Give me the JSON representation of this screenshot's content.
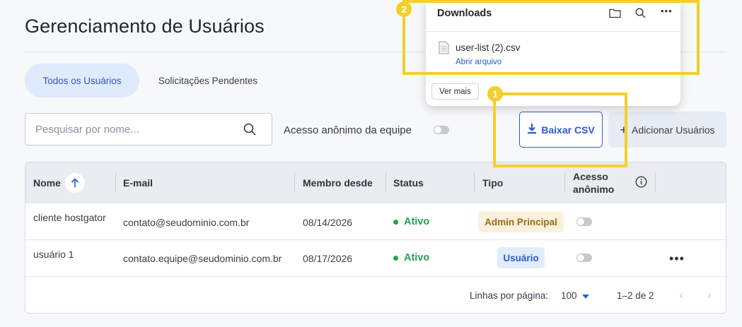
{
  "page": {
    "title": "Gerenciamento de Usuários"
  },
  "tabs": [
    {
      "label": "Todos os Usuários",
      "active": true
    },
    {
      "label": "Solicitações Pendentes",
      "active": false
    }
  ],
  "search": {
    "placeholder": "Pesquisar por nome...",
    "value": "",
    "icon": "search-icon"
  },
  "anonymous_access": {
    "label": "Acesso anônimo da equipe",
    "enabled": false
  },
  "toolbar": {
    "download_csv_label": "Baixar CSV",
    "add_users_label": "Adicionar Usuários"
  },
  "table": {
    "columns": [
      "Nome",
      "E-mail",
      "Membro desde",
      "Status",
      "Tipo",
      "Acesso anônimo"
    ],
    "rows": [
      {
        "name": "cliente hostgator",
        "email": "contato@seudominio.com.br",
        "member_since": "08/14/2026",
        "status": "Ativo",
        "type": "Admin Principal",
        "anonymous": false
      },
      {
        "name": "usuário 1",
        "email": "contato.equipe@seudominio.com.br",
        "member_since": "08/17/2026",
        "status": "Ativo",
        "type": "Usuário",
        "anonymous": false
      }
    ],
    "pagination": {
      "rows_per_page_label": "Linhas por página:",
      "rows_per_page": "100",
      "range": "1–2 de 2"
    }
  },
  "downloads_panel": {
    "title": "Downloads",
    "file_name": "user-list (2).csv",
    "open_label": "Abrir arquivo",
    "see_more_label": "Ver mais"
  },
  "annotations": {
    "marker_1": "1",
    "marker_2": "2"
  },
  "colors": {
    "accent": "#2a5bd0",
    "highlight": "#f4cf26",
    "active_status": "#22a354"
  }
}
